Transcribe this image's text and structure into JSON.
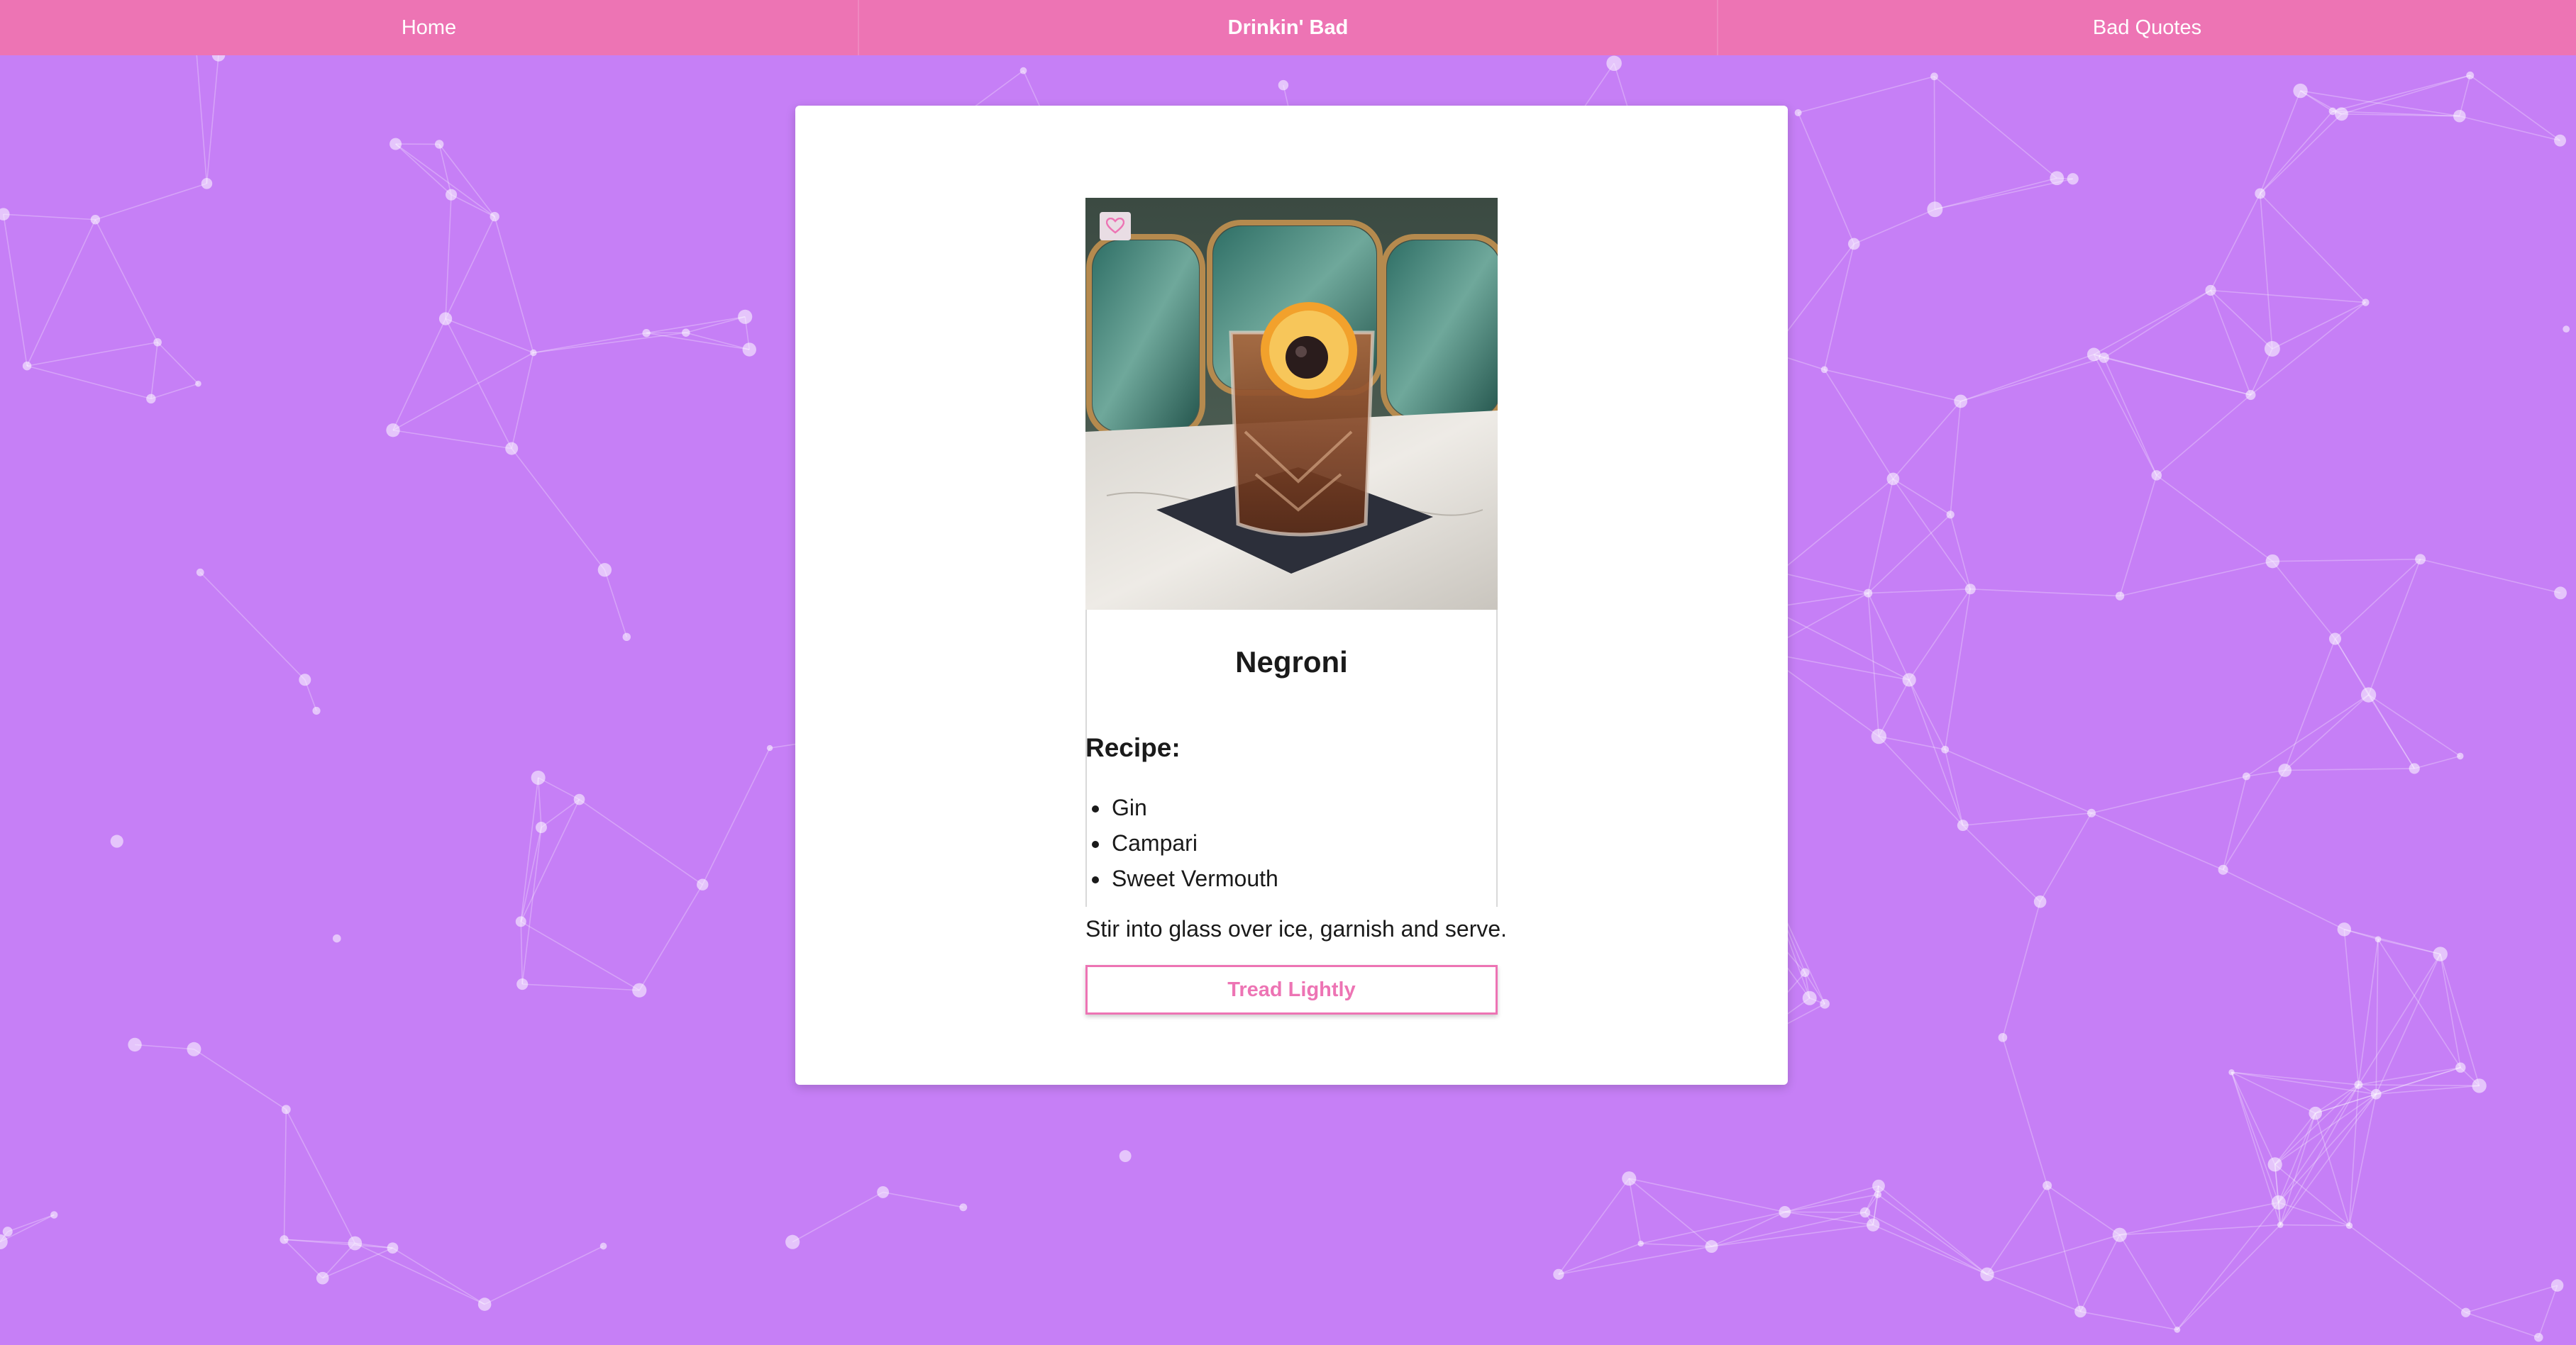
{
  "nav": {
    "items": [
      {
        "label": "Home"
      },
      {
        "label": "Drinkin' Bad"
      },
      {
        "label": "Bad Quotes"
      }
    ],
    "active_index": 1
  },
  "card": {
    "image_icon": "cocktail-photo",
    "favorite_icon": "heart-icon",
    "name": "Negroni",
    "recipe_heading": "Recipe:",
    "ingredients": [
      "Gin",
      "Campari",
      "Sweet Vermouth"
    ],
    "instructions": "Stir into glass over ice, garnish and serve."
  },
  "action": {
    "button_label": "Tread Lightly"
  },
  "colors": {
    "background": "#c67ff6",
    "navbar": "#ed74b4",
    "accent": "#ed74b4",
    "panel": "#ffffff"
  }
}
